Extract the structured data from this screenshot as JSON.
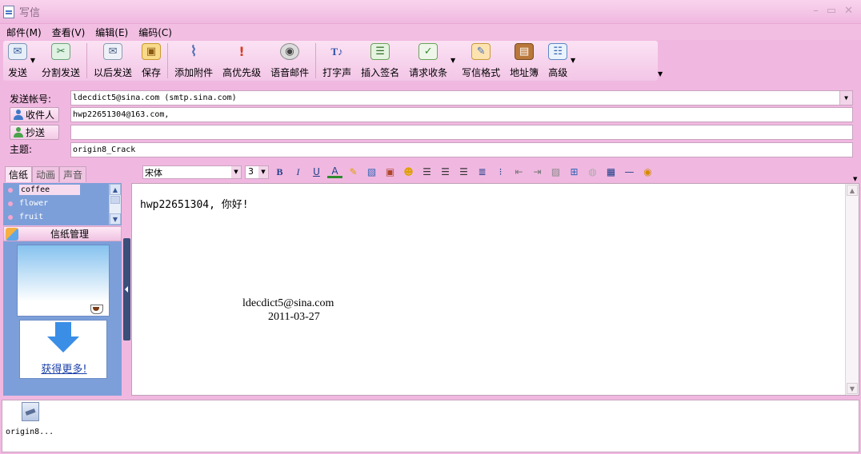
{
  "window": {
    "title": "写信"
  },
  "menu": {
    "items": [
      "邮件(M)",
      "查看(V)",
      "编辑(E)",
      "编码(C)"
    ]
  },
  "toolbar": {
    "send": "发送",
    "split_send": "分割发送",
    "send_later": "以后发送",
    "save": "保存",
    "add_attachment": "添加附件",
    "priority": "高优先级",
    "voice_mail": "语音邮件",
    "typing_sound": "打字声",
    "insert_signature": "插入签名",
    "request_receipt": "请求收条",
    "mail_format": "写信格式",
    "address_book": "地址簿",
    "advanced": "高级"
  },
  "fields": {
    "account_label": "发送帐号:",
    "account_value": "ldecdict5@sina.com  (smtp.sina.com)",
    "to_label": "收件人",
    "to_value": "hwp22651304@163.com,",
    "cc_label": "抄送",
    "cc_value": "",
    "subject_label": "主题:",
    "subject_value": "origin8_Crack"
  },
  "tabs": [
    "信纸",
    "动画",
    "声音"
  ],
  "format": {
    "font": "宋体",
    "size": "3"
  },
  "stationery": {
    "items": [
      "coffee",
      "flower",
      "fruit"
    ],
    "manager_label": "信纸管理",
    "more_link": "获得更多!"
  },
  "editor": {
    "greeting": "hwp22651304, 你好!",
    "signature_email": "ldecdict5@sina.com",
    "signature_date": "2011-03-27"
  },
  "attachments": [
    {
      "name": "origin8..."
    }
  ]
}
